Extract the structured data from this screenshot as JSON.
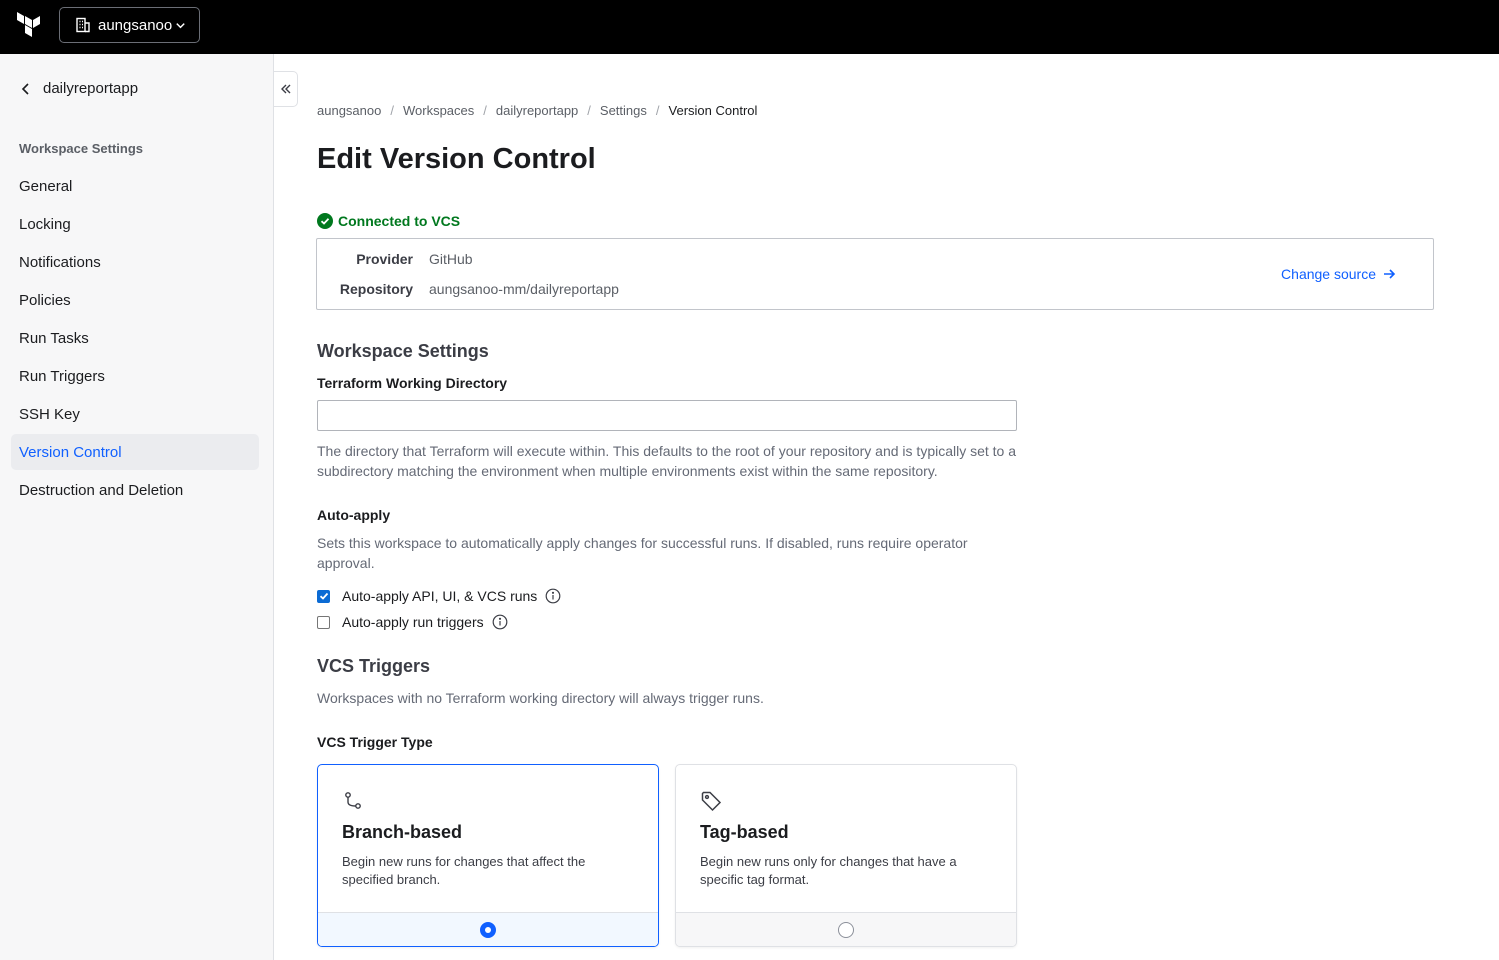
{
  "colors": {
    "topbar_bg": "#000000",
    "link": "#1060ff",
    "success": "#00781e",
    "sidebar_bg": "#f7f7f8"
  },
  "header": {
    "org_name": "aungsanoo",
    "logo_icon": "terraform-logo-icon",
    "org_icon": "building-icon",
    "dropdown_icon": "chevron-down-icon"
  },
  "sidebar": {
    "back_label": "dailyreportapp",
    "section_heading": "Workspace Settings",
    "items": [
      {
        "label": "General",
        "active": false
      },
      {
        "label": "Locking",
        "active": false
      },
      {
        "label": "Notifications",
        "active": false
      },
      {
        "label": "Policies",
        "active": false
      },
      {
        "label": "Run Tasks",
        "active": false
      },
      {
        "label": "Run Triggers",
        "active": false
      },
      {
        "label": "SSH Key",
        "active": false
      },
      {
        "label": "Version Control",
        "active": true
      },
      {
        "label": "Destruction and Deletion",
        "active": false
      }
    ]
  },
  "breadcrumb": [
    "aungsanoo",
    "Workspaces",
    "dailyreportapp",
    "Settings",
    "Version Control"
  ],
  "page": {
    "title": "Edit Version Control",
    "connected_label": "Connected to VCS",
    "provider_key": "Provider",
    "provider_value": "GitHub",
    "repository_key": "Repository",
    "repository_value": "aungsanoo-mm/dailyreportapp",
    "change_source_label": "Change source"
  },
  "workspace_settings": {
    "heading": "Workspace Settings",
    "working_dir_label": "Terraform Working Directory",
    "working_dir_value": "",
    "working_dir_help": "The directory that Terraform will execute within. This defaults to the root of your repository and is typically set to a subdirectory matching the environment when multiple environments exist within the same repository.",
    "auto_apply_label": "Auto-apply",
    "auto_apply_help": "Sets this workspace to automatically apply changes for successful runs. If disabled, runs require operator approval.",
    "auto_apply_vcs_label": "Auto-apply API, UI, & VCS runs",
    "auto_apply_vcs_checked": true,
    "auto_apply_triggers_label": "Auto-apply run triggers",
    "auto_apply_triggers_checked": false
  },
  "vcs_triggers": {
    "heading": "VCS Triggers",
    "help": "Workspaces with no Terraform working directory will always trigger runs.",
    "type_label": "VCS Trigger Type",
    "options": [
      {
        "title": "Branch-based",
        "description": "Begin new runs for changes that affect the specified branch.",
        "icon": "git-branch-icon",
        "selected": true
      },
      {
        "title": "Tag-based",
        "description": "Begin new runs only for changes that have a specific tag format.",
        "icon": "tag-icon",
        "selected": false
      }
    ]
  }
}
